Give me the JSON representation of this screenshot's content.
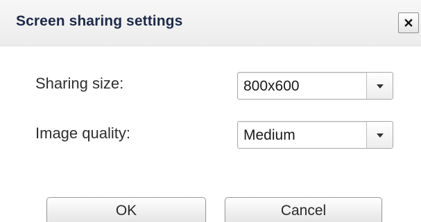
{
  "dialog": {
    "title": "Screen sharing settings",
    "close_icon": "close-icon"
  },
  "fields": {
    "sharing_size": {
      "label": "Sharing size:",
      "value": "800x600",
      "icon": "chevron-down-icon"
    },
    "image_quality": {
      "label": "Image quality:",
      "value": "Medium",
      "icon": "chevron-down-icon"
    }
  },
  "buttons": {
    "ok_label": "OK",
    "cancel_label": "Cancel"
  },
  "colors": {
    "title_text": "#1d2a4a",
    "titlebar_bg": "#efefef",
    "border": "#a8a8a8"
  }
}
